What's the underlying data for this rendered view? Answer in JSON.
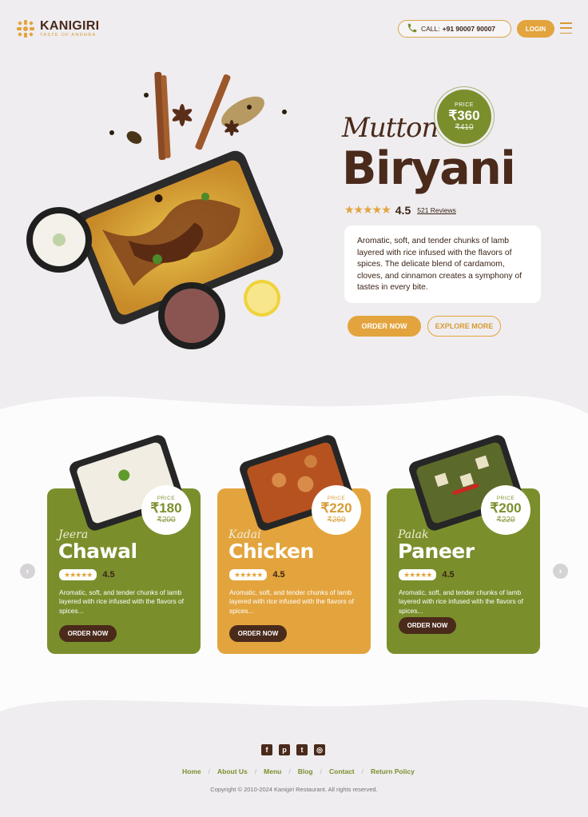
{
  "header": {
    "brand": "KANIGIRI",
    "tagline": "TASTE OF ANDHRA",
    "call_label": "CALL:",
    "call_number": "+91 90007 90007",
    "login_label": "LOGIN"
  },
  "hero": {
    "script_title": "Mutton",
    "title": "Biryani",
    "price_label": "PRICE",
    "price_now": "₹360",
    "price_old": "₹410",
    "rating": "4.5",
    "stars": "★★★★★",
    "reviews": "521 Reviews",
    "description": "Aromatic, soft, and tender chunks of lamb layered with rice infused with the flavors of spices. The delicate blend of cardamom, cloves, and cinnamon creates a symphony of tastes in every bite.",
    "order_label": "ORDER NOW",
    "explore_label": "EXPLORE MORE"
  },
  "cards": [
    {
      "script": "Jeera",
      "title": "Chawal",
      "price_label": "PRICE",
      "price_now": "₹180",
      "price_old": "₹200",
      "stars": "★★★★★",
      "rating": "4.5",
      "description": "Aromatic, soft, and tender chunks of lamb layered with rice infused with the flavors of spices...",
      "order_label": "ORDER NOW"
    },
    {
      "script": "Kadai",
      "title": "Chicken",
      "price_label": "PRICE",
      "price_now": "₹220",
      "price_old": "₹260",
      "stars": "★★★★★",
      "rating": "4.5",
      "description": "Aromatic, soft, and tender chunks of lamb layered with rice infused with the flavors of spices...",
      "order_label": "ORDER NOW"
    },
    {
      "script": "Palak",
      "title": "Paneer",
      "price_label": "PRICE",
      "price_now": "₹200",
      "price_old": "₹220",
      "stars": "★★★★★",
      "rating": "4.5",
      "description": "Aromatic, soft, and tender chunks of lamb layered with rice infused with the flavors of spices...",
      "order_label": "ORDER NOW"
    }
  ],
  "carousel": {
    "prev_icon": "chevron-left-icon",
    "next_icon": "chevron-right-icon"
  },
  "footer": {
    "social": [
      "facebook-icon",
      "pinterest-icon",
      "twitter-icon",
      "instagram-icon"
    ],
    "nav": [
      "Home",
      "About Us",
      "Menu",
      "Blog",
      "Contact",
      "Return Policy"
    ],
    "copyright": "Copyright © 2010-2024 Kanigiri Restaurant. All rights reserved."
  },
  "colors": {
    "brand_brown": "#4a2a1b",
    "accent_orange": "#e3a43d",
    "olive_green": "#7a8f2c",
    "background": "#efedf0"
  }
}
